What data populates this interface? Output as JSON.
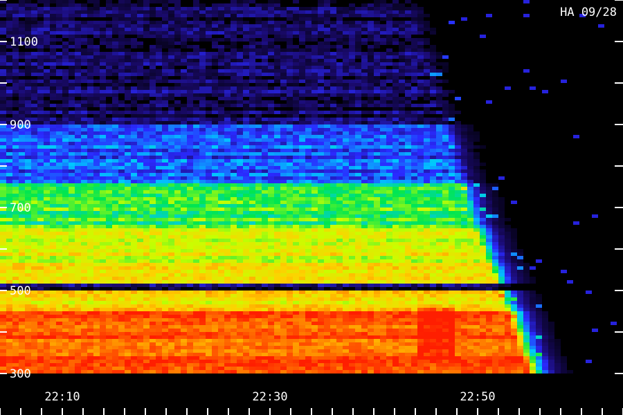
{
  "chart_data": {
    "type": "heatmap",
    "title": "HA 09/28",
    "xlabel": "",
    "ylabel": "",
    "x_unit": "time (HH:MM)",
    "y_unit": "frequency",
    "x_range_minutes": [
      1324,
      1384
    ],
    "y_range": [
      300,
      1200
    ],
    "x_tick_labels": [
      "22:10",
      "22:30",
      "22:50"
    ],
    "x_tick_label_minutes": [
      1330,
      1350,
      1370
    ],
    "x_minor_tick_every_minutes": 2,
    "y_tick_labels": [
      "1100",
      "900",
      "700",
      "500",
      "300"
    ],
    "y_tick_label_values": [
      1100,
      900,
      700,
      500,
      300
    ],
    "y_minor_tick_every": 100,
    "colormap": [
      "#000000",
      "#1a0a6e",
      "#2a2aff",
      "#00c8ff",
      "#00e650",
      "#c8ff00",
      "#ffd000",
      "#ff7a00",
      "#ff1e00"
    ],
    "intensity_bands": [
      {
        "freq": [
          300,
          450
        ],
        "level": 0.92,
        "note": "strongest emission (red-orange)"
      },
      {
        "freq": [
          450,
          500
        ],
        "level": 0.72
      },
      {
        "freq": [
          500,
          515
        ],
        "level": 0.1,
        "note": "dark narrow gap"
      },
      {
        "freq": [
          515,
          650
        ],
        "level": 0.68,
        "note": "yellow-green"
      },
      {
        "freq": [
          650,
          760
        ],
        "level": 0.52,
        "note": "green-cyan"
      },
      {
        "freq": [
          760,
          900
        ],
        "level": 0.28,
        "note": "blue"
      },
      {
        "freq": [
          900,
          1200
        ],
        "level": 0.1,
        "note": "faint violet"
      }
    ],
    "end_time_minutes_by_freq": [
      [
        300,
        1375
      ],
      [
        500,
        1372
      ],
      [
        700,
        1369
      ],
      [
        900,
        1367
      ],
      [
        1200,
        1363
      ]
    ],
    "bright_patch": {
      "time_minutes": [
        1364,
        1368
      ],
      "freq": [
        330,
        460
      ]
    },
    "background": "#000000"
  }
}
